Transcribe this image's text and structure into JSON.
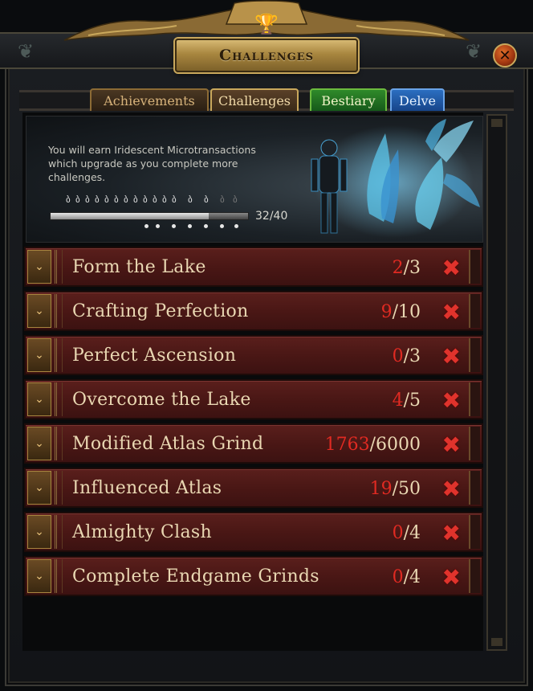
{
  "window": {
    "title": "Challenges"
  },
  "icons": {
    "trophy": "trophy-icon",
    "close": "close-icon",
    "expander": "chevron-down-icon",
    "failed": "x-mark-icon"
  },
  "colors": {
    "accent_gold": "#c9a85c",
    "row_red": "#4a1715",
    "progress_red": "#e02a22",
    "bestiary_green": "#2f8a2a",
    "delve_blue": "#2b6ec0"
  },
  "tabs": [
    {
      "label": "Achievements"
    },
    {
      "label": "Challenges"
    },
    {
      "label": "Bestiary"
    },
    {
      "label": "Delve"
    }
  ],
  "reward": {
    "text": "You will earn Iridescent Microtransactions which upgrade as you complete more challenges.",
    "progress_label": "32/40",
    "progress_fraction": 0.8
  },
  "challenges": [
    {
      "title": "Form the Lake",
      "current": "2",
      "total": "/3"
    },
    {
      "title": "Crafting Perfection",
      "current": "9",
      "total": "/10"
    },
    {
      "title": "Perfect Ascension",
      "current": "0",
      "total": "/3"
    },
    {
      "title": "Overcome the Lake",
      "current": "4",
      "total": "/5"
    },
    {
      "title": "Modified Atlas Grind",
      "current": "1763",
      "total": "/6000"
    },
    {
      "title": "Influenced Atlas",
      "current": "19",
      "total": "/50"
    },
    {
      "title": "Almighty Clash",
      "current": "0",
      "total": "/4"
    },
    {
      "title": "Complete Endgame Grinds",
      "current": "0",
      "total": "/4"
    }
  ]
}
